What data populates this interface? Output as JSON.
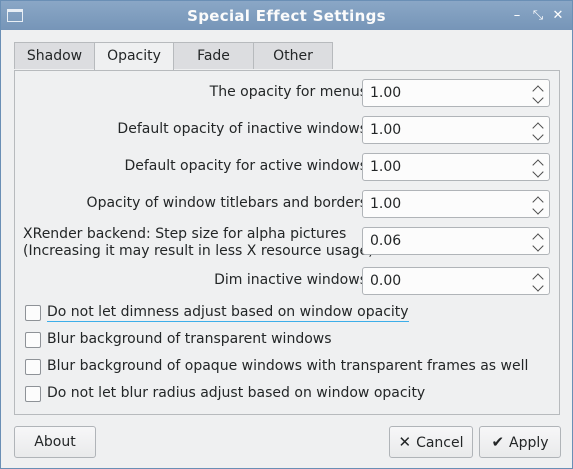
{
  "window": {
    "title": "Special Effect Settings"
  },
  "titlebar": {
    "minimize": "–",
    "maximize": "⤡",
    "close": "✕"
  },
  "tabs": [
    {
      "label": "Shadow",
      "active": false
    },
    {
      "label": "Opacity",
      "active": true
    },
    {
      "label": "Fade",
      "active": false
    },
    {
      "label": "Other",
      "active": false
    }
  ],
  "settings": [
    {
      "label": "The opacity for menus",
      "value": "1.00"
    },
    {
      "label": "Default opacity of inactive windows",
      "value": "1.00"
    },
    {
      "label": "Default opacity for active windows",
      "value": "1.00"
    },
    {
      "label": "Opacity of window titlebars and borders",
      "value": "1.00"
    },
    {
      "label": "XRender backend: Step size for alpha pictures",
      "label2": "(Increasing it may result in less X resource usage)",
      "value": "0.06"
    },
    {
      "label": "Dim inactive windows",
      "value": "0.00"
    }
  ],
  "checkboxes": [
    {
      "label": "Do not let dimness adjust based on window opacity",
      "checked": false
    },
    {
      "label": "Blur background of transparent windows",
      "checked": false
    },
    {
      "label": "Blur background of opaque windows with transparent frames as well",
      "checked": false
    },
    {
      "label": "Do not let blur radius adjust based on window opacity",
      "checked": false
    }
  ],
  "buttons": {
    "about": "About",
    "cancel": "Cancel",
    "cancel_icon": "✕",
    "apply": "Apply",
    "apply_icon": "✔"
  }
}
